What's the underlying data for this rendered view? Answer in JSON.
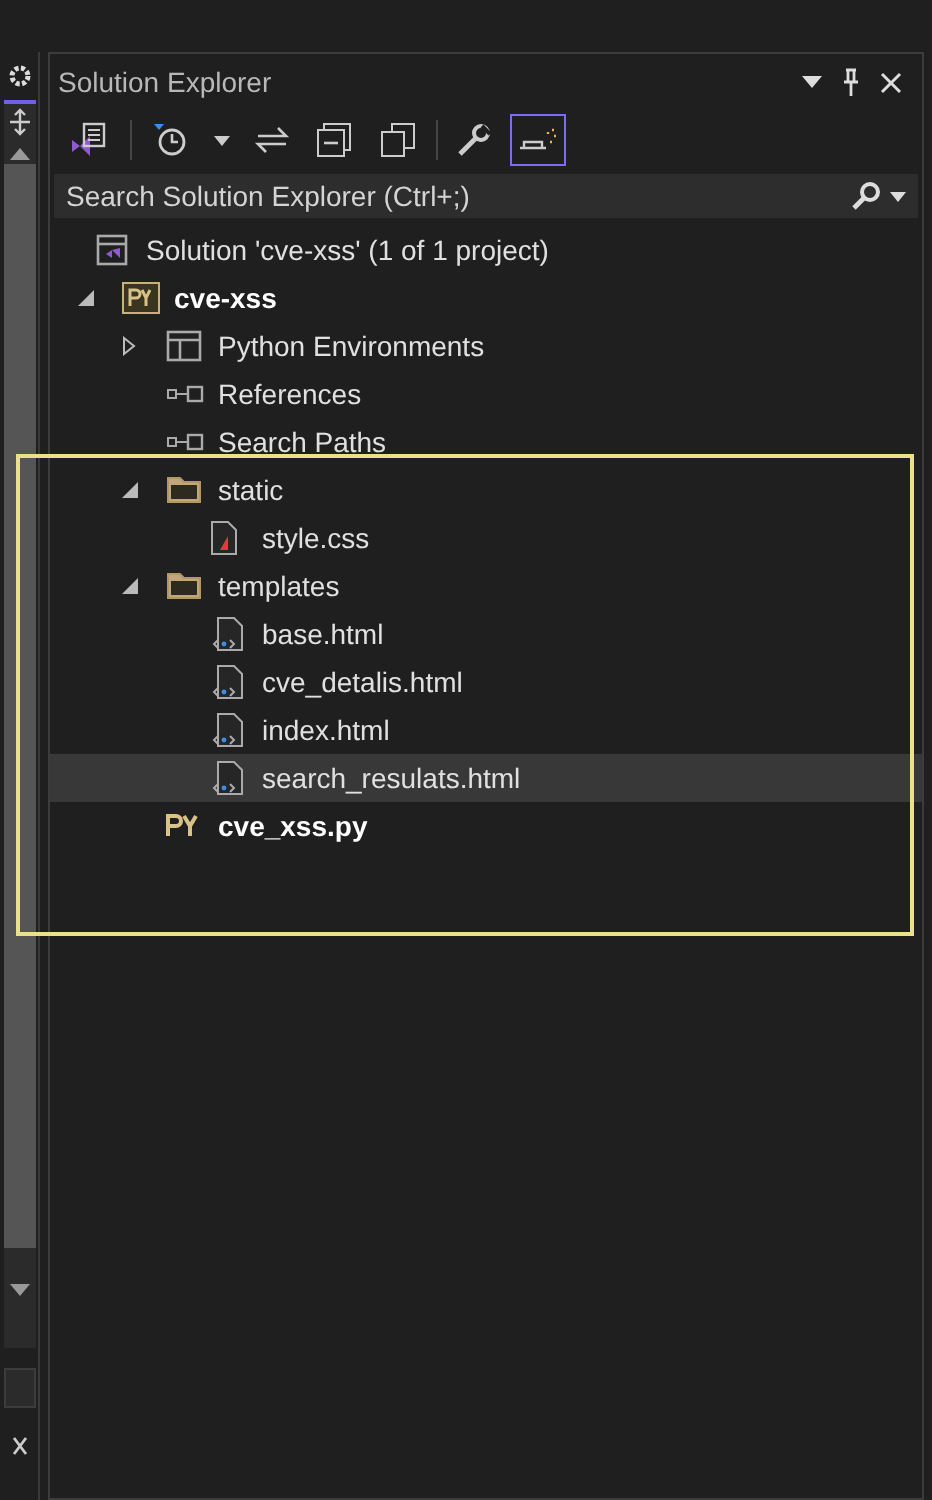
{
  "panel": {
    "title": "Solution Explorer"
  },
  "search": {
    "placeholder": "Search Solution Explorer (Ctrl+;)"
  },
  "toolbar": [
    {
      "kind": "switch-views",
      "selected": false
    },
    {
      "kind": "pending-changes",
      "selected": false
    },
    {
      "kind": "dropdown",
      "selected": false
    },
    {
      "kind": "sync",
      "selected": false
    },
    {
      "kind": "collapse-all",
      "selected": false
    },
    {
      "kind": "show-all",
      "selected": false
    },
    {
      "kind": "properties",
      "selected": false
    },
    {
      "kind": "preview",
      "selected": true
    }
  ],
  "tree": [
    {
      "label": "Solution 'cve-xss' (1 of 1 project)",
      "kind": "solution",
      "emphasized": false,
      "selected": false,
      "children": [
        {
          "label": "cve-xss",
          "kind": "python-project",
          "emphasized": true,
          "selected": false,
          "expanded": true,
          "children": [
            {
              "label": "Python Environments",
              "kind": "environments",
              "emphasized": false,
              "selected": false,
              "expanded": false
            },
            {
              "label": "References",
              "kind": "references",
              "emphasized": false,
              "selected": false
            },
            {
              "label": "Search Paths",
              "kind": "references",
              "emphasized": false,
              "selected": false
            },
            {
              "label": "static",
              "kind": "folder",
              "emphasized": false,
              "selected": false,
              "expanded": true,
              "children": [
                {
                  "label": "style.css",
                  "kind": "css-file",
                  "emphasized": false,
                  "selected": false
                }
              ]
            },
            {
              "label": "templates",
              "kind": "folder",
              "emphasized": false,
              "selected": false,
              "expanded": true,
              "children": [
                {
                  "label": "base.html",
                  "kind": "html-file",
                  "emphasized": false,
                  "selected": false
                },
                {
                  "label": "cve_detalis.html",
                  "kind": "html-file",
                  "emphasized": false,
                  "selected": false
                },
                {
                  "label": "index.html",
                  "kind": "html-file",
                  "emphasized": false,
                  "selected": false
                },
                {
                  "label": "search_resulats.html",
                  "kind": "html-file",
                  "emphasized": false,
                  "selected": true
                }
              ]
            },
            {
              "label": "cve_xss.py",
              "kind": "python-file",
              "emphasized": true,
              "selected": false
            }
          ]
        }
      ]
    }
  ],
  "highlight_frame": true
}
